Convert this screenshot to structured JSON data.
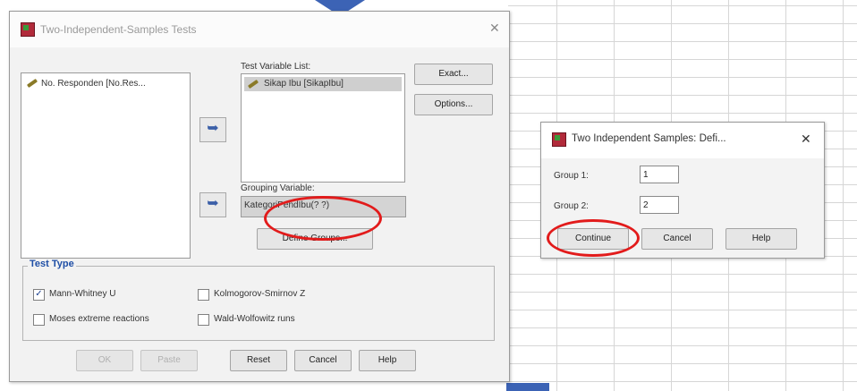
{
  "colors": {
    "accent_blue": "#3c63b5",
    "highlight_red": "#e21b1b",
    "legend_blue": "#1f4fa6"
  },
  "main_dialog": {
    "title": "Two-Independent-Samples Tests",
    "source_list": [
      "No. Responden [No.Res..."
    ],
    "test_variable_label": "Test Variable List:",
    "test_variables": [
      "Sikap Ibu [SikapIbu]"
    ],
    "grouping_label": "Grouping Variable:",
    "grouping_value": "KategoriPendIbu(? ?)",
    "define_groups_label": "Define Groups...",
    "side_buttons": {
      "exact": "Exact...",
      "options": "Options..."
    },
    "test_type": {
      "legend": "Test Type",
      "options": [
        {
          "label": "Mann-Whitney U",
          "checked": true
        },
        {
          "label": "Kolmogorov-Smirnov Z",
          "checked": false
        },
        {
          "label": "Moses extreme reactions",
          "checked": false
        },
        {
          "label": "Wald-Wolfowitz runs",
          "checked": false
        }
      ]
    },
    "buttons": {
      "ok": "OK",
      "paste": "Paste",
      "reset": "Reset",
      "cancel": "Cancel",
      "help": "Help"
    }
  },
  "define_dialog": {
    "title": "Two Independent Samples: Defi...",
    "group1_label": "Group 1:",
    "group1_value": "1",
    "group2_label": "Group 2:",
    "group2_value": "2",
    "buttons": {
      "continue": "Continue",
      "cancel": "Cancel",
      "help": "Help"
    }
  },
  "icons": [
    "app-icon",
    "close-icon",
    "variable-pencil-icon",
    "move-arrow-icon",
    "checkbox-icon",
    "arrow-down-icon"
  ]
}
